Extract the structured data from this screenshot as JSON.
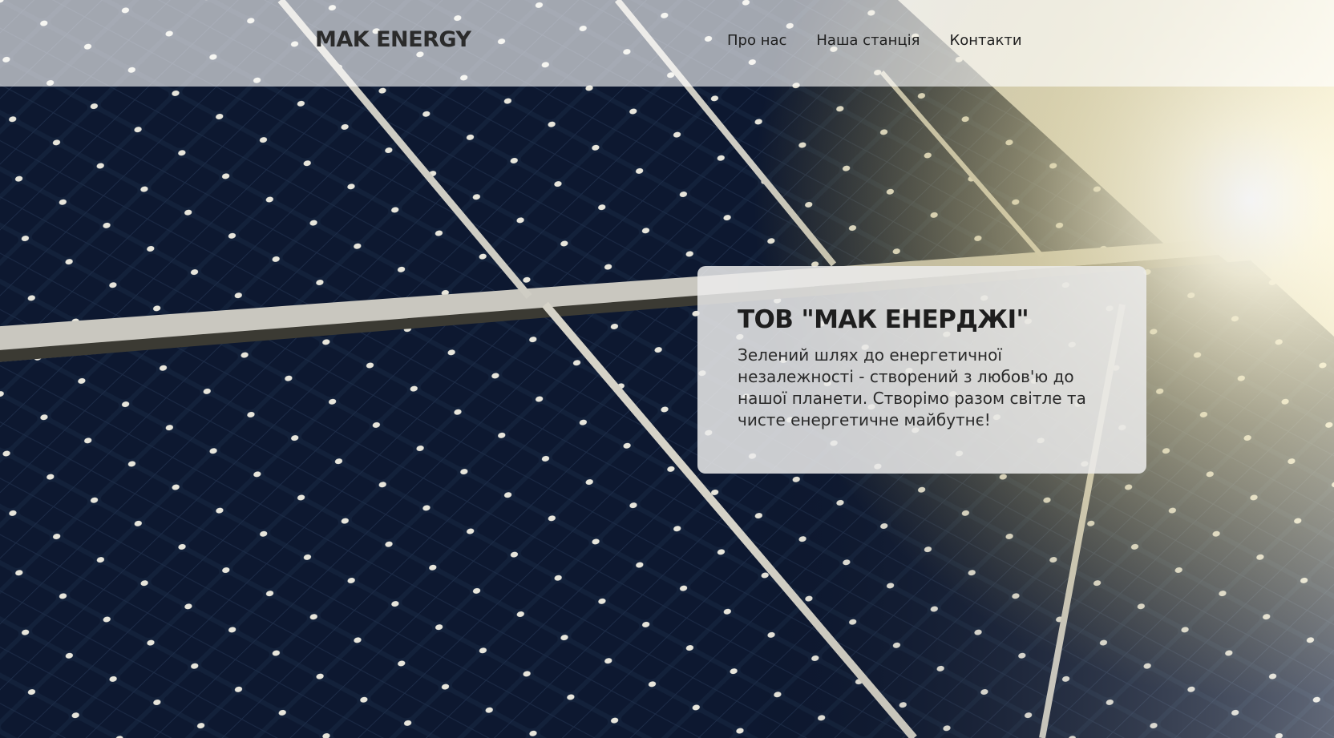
{
  "header": {
    "logo": "MAK ENERGY",
    "nav": [
      {
        "label": "Про нас"
      },
      {
        "label": "Наша станція"
      },
      {
        "label": "Контакти"
      }
    ]
  },
  "hero": {
    "title": "ТОВ \"МАК ЕНЕРДЖІ\"",
    "text": "Зелений шлях до енергетичної незалежності - створений з любов'ю до нашої планети. Створімо разом світле та чисте енергетичне майбутнє!"
  },
  "colors": {
    "panel_dark": "#0f1c33",
    "panel_grid": "#d8d8d0",
    "sun_glow": "#fff6cc",
    "header_overlay": "#ffffff",
    "card_bg": "#ebebeb"
  }
}
